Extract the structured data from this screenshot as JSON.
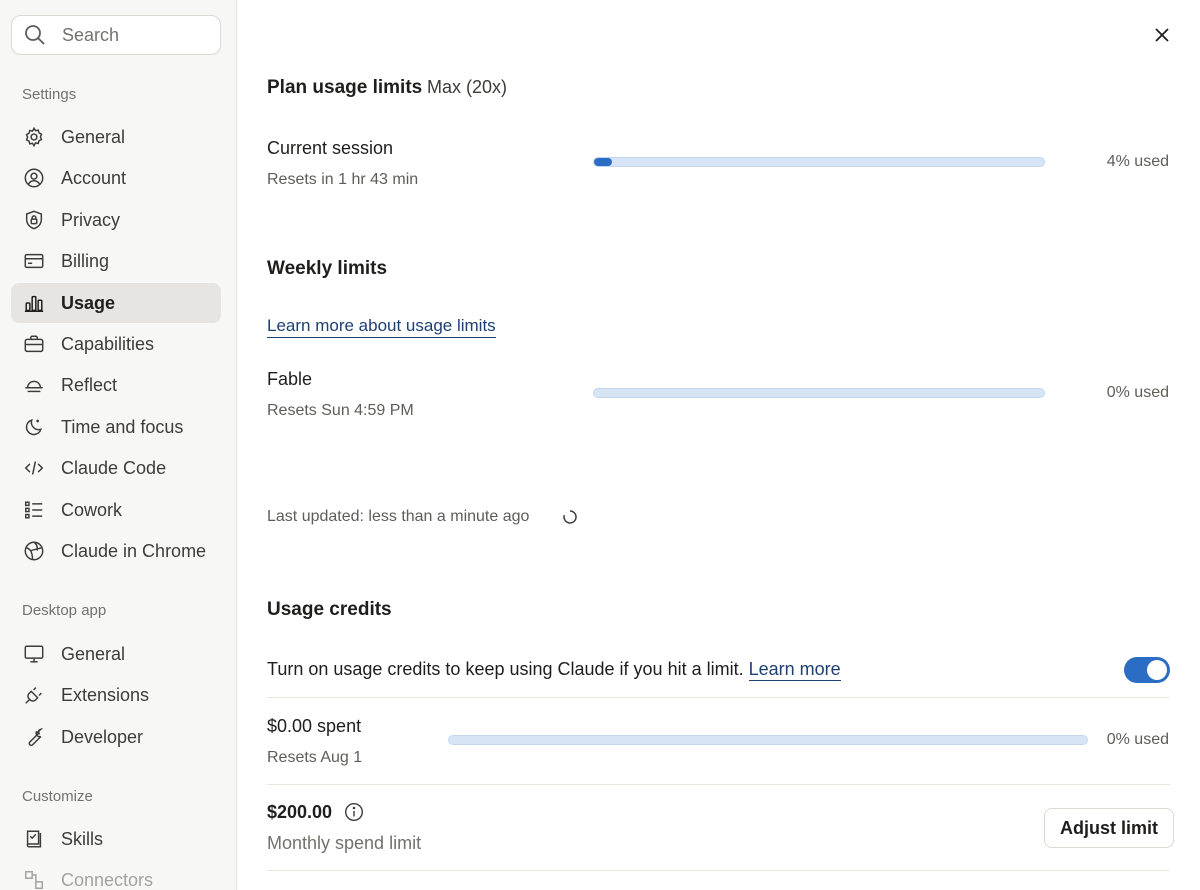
{
  "sidebar": {
    "search_placeholder": "Search",
    "sections": [
      {
        "label": "Settings"
      },
      {
        "label": "Desktop app"
      },
      {
        "label": "Customize"
      }
    ],
    "settings_items": [
      {
        "label": "General",
        "icon": "gear-icon"
      },
      {
        "label": "Account",
        "icon": "user-circle-icon"
      },
      {
        "label": "Privacy",
        "icon": "shield-lock-icon"
      },
      {
        "label": "Billing",
        "icon": "credit-card-icon"
      },
      {
        "label": "Usage",
        "icon": "bar-chart-icon",
        "active": true
      },
      {
        "label": "Capabilities",
        "icon": "briefcase-icon"
      },
      {
        "label": "Reflect",
        "icon": "sunset-icon"
      },
      {
        "label": "Time and focus",
        "icon": "moon-icon"
      },
      {
        "label": "Claude Code",
        "icon": "code-icon"
      },
      {
        "label": "Cowork",
        "icon": "checklist-icon"
      },
      {
        "label": "Claude in Chrome",
        "icon": "globe-icon"
      }
    ],
    "desktop_items": [
      {
        "label": "General",
        "icon": "monitor-icon"
      },
      {
        "label": "Extensions",
        "icon": "plug-icon"
      },
      {
        "label": "Developer",
        "icon": "wrench-icon"
      }
    ],
    "customize_items": [
      {
        "label": "Skills",
        "icon": "skills-icon"
      },
      {
        "label": "Connectors",
        "icon": "connectors-icon"
      }
    ]
  },
  "main": {
    "plan": {
      "title": "Plan usage limits",
      "badge": "Max (20x)",
      "current_session": {
        "title": "Current session",
        "reset": "Resets in 1 hr 43 min",
        "percent_label": "4% used",
        "fraction": 0.04
      }
    },
    "weekly": {
      "title": "Weekly limits",
      "learn_link": "Learn more about usage limits",
      "fable": {
        "title": "Fable",
        "reset": "Resets Sun 4:59 PM",
        "percent_label": "0% used",
        "fraction": 0
      },
      "last_updated": "Last updated: less than a minute ago"
    },
    "credits": {
      "title": "Usage credits",
      "toggle_text": "Turn on usage credits to keep using Claude if you hit a limit.",
      "toggle_link": "Learn more",
      "toggle_on": true,
      "spent": {
        "title": "$0.00 spent",
        "reset": "Resets Aug 1",
        "percent_label": "0% used",
        "fraction": 0
      },
      "limit": {
        "amount": "$200.00",
        "label": "Monthly spend limit",
        "button": "Adjust limit"
      }
    }
  },
  "colors": {
    "accent": "#2b6cc4",
    "bar_track": "#d6e4f6",
    "link": "#1d3f73"
  }
}
